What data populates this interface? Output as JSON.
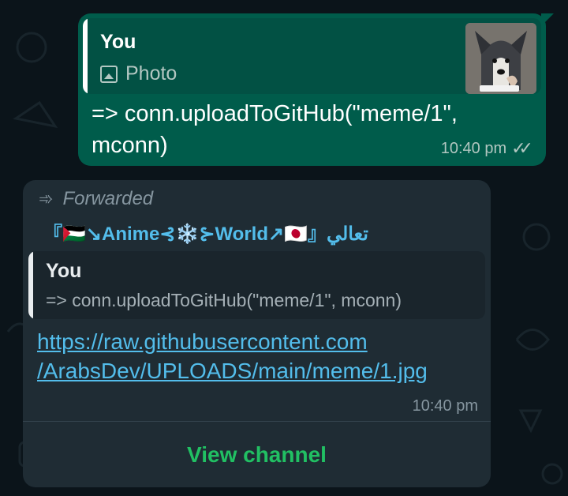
{
  "outgoing_message": {
    "reply": {
      "name": "You",
      "attachment_label": "Photo",
      "attachment_icon": "photo-icon"
    },
    "text": "=> conn.uploadToGitHub(\"meme/1\", mconn)",
    "time": "10:40 pm",
    "status_icon": "double-check-icon",
    "bubble_color": "#005c4b"
  },
  "incoming_message": {
    "forwarded_label": "Forwarded",
    "forwarded_icon": "forward-arrows-icon",
    "sender": "『🇵🇸↘Anime⊰❄️⊱World↗🇯🇵』تعالي",
    "reply": {
      "name": "You",
      "text": "=> conn.uploadToGitHub(\"meme/1\", mconn)"
    },
    "link_lines": [
      "https://raw.githubusercontent.com",
      "/ArabsDev/UPLOADS/main/meme/1.jpg"
    ],
    "time": "10:40 pm",
    "action_label": "View channel",
    "bubble_color": "#1f2c34",
    "link_color": "#53bdeb",
    "action_color": "#21c063"
  }
}
